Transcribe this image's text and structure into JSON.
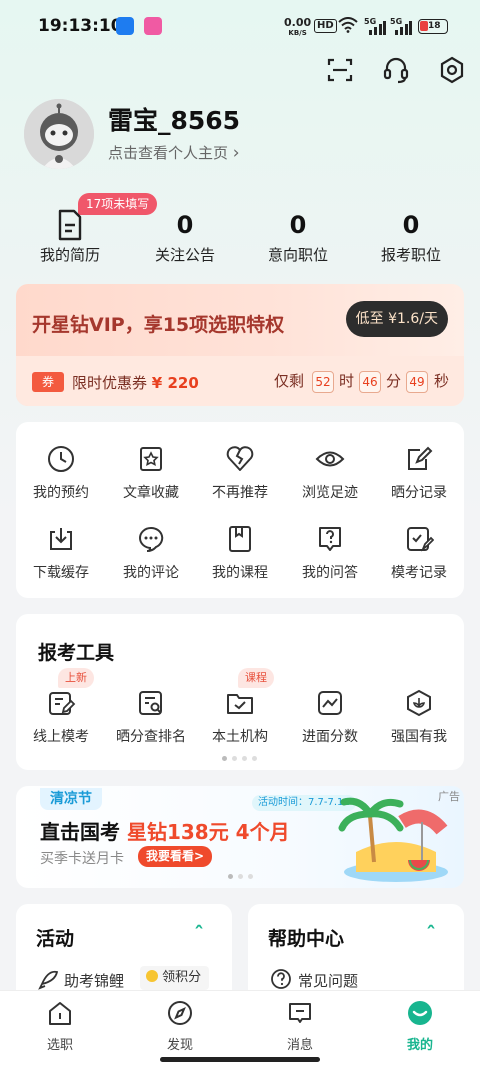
{
  "status_bar": {
    "time": "19:13:10",
    "net_speed": "0.00",
    "net_unit": "KB/S",
    "hd": "HD",
    "signal1": "5G",
    "signal2": "5G",
    "battery": "18"
  },
  "profile": {
    "username": "雷宝_8565",
    "subtitle": "点击查看个人主页",
    "chevron": "›"
  },
  "stats": {
    "resume_badge": "17项未填写",
    "resume_label": "我的简历",
    "items": [
      {
        "value": "0",
        "label": "关注公告"
      },
      {
        "value": "0",
        "label": "意向职位"
      },
      {
        "value": "0",
        "label": "报考职位"
      }
    ]
  },
  "vip": {
    "title": "开星钻VIP，享15项选职特权",
    "button": "低至 ¥1.6/天",
    "coupon_tag": "券",
    "coupon_text": "限时优惠券",
    "coupon_amount": "¥ 220",
    "remaining_label": "仅剩",
    "hours": "52",
    "hours_unit": "时",
    "minutes": "46",
    "minutes_unit": "分",
    "seconds": "49",
    "seconds_unit": "秒"
  },
  "quick_grid": [
    {
      "label": "我的预约",
      "icon": "clock-icon"
    },
    {
      "label": "文章收藏",
      "icon": "star-bookmark-icon"
    },
    {
      "label": "不再推荐",
      "icon": "broken-heart-icon"
    },
    {
      "label": "浏览足迹",
      "icon": "eye-icon"
    },
    {
      "label": "晒分记录",
      "icon": "edit-note-icon"
    },
    {
      "label": "下载缓存",
      "icon": "download-icon"
    },
    {
      "label": "我的评论",
      "icon": "comment-icon"
    },
    {
      "label": "我的课程",
      "icon": "book-icon"
    },
    {
      "label": "我的问答",
      "icon": "question-icon"
    },
    {
      "label": "模考记录",
      "icon": "exam-record-icon"
    }
  ],
  "tools": {
    "title": "报考工具",
    "items": [
      {
        "label": "线上模考",
        "tag": "上新",
        "icon": "online-exam-icon"
      },
      {
        "label": "晒分查排名",
        "tag": "",
        "icon": "rank-search-icon"
      },
      {
        "label": "本土机构",
        "tag": "课程",
        "icon": "folder-check-icon"
      },
      {
        "label": "进面分数",
        "tag": "",
        "icon": "score-chart-icon"
      },
      {
        "label": "强国有我",
        "tag": "",
        "icon": "badge-icon"
      }
    ]
  },
  "banner": {
    "festival": "清凉节",
    "ad_label": "广告",
    "activity_time": "活动时间：7.7-7.11",
    "headline_a": "直击国考",
    "headline_b": "星钻138元 4个月",
    "subline": "买季卡送月卡",
    "cta": "我要看看>"
  },
  "activity": {
    "title": "活动",
    "item": "助考锦鲤",
    "points": "领积分",
    "collapse": "ˆ"
  },
  "help": {
    "title": "帮助中心",
    "item": "常见问题",
    "collapse": "ˆ"
  },
  "tabbar": [
    {
      "label": "选职",
      "icon": "home-icon"
    },
    {
      "label": "发现",
      "icon": "compass-icon"
    },
    {
      "label": "消息",
      "icon": "message-icon"
    },
    {
      "label": "我的",
      "icon": "me-icon"
    }
  ],
  "colors": {
    "accent": "#18b58f",
    "vip_red": "#e8401f",
    "badge_pink": "#f0576a"
  }
}
